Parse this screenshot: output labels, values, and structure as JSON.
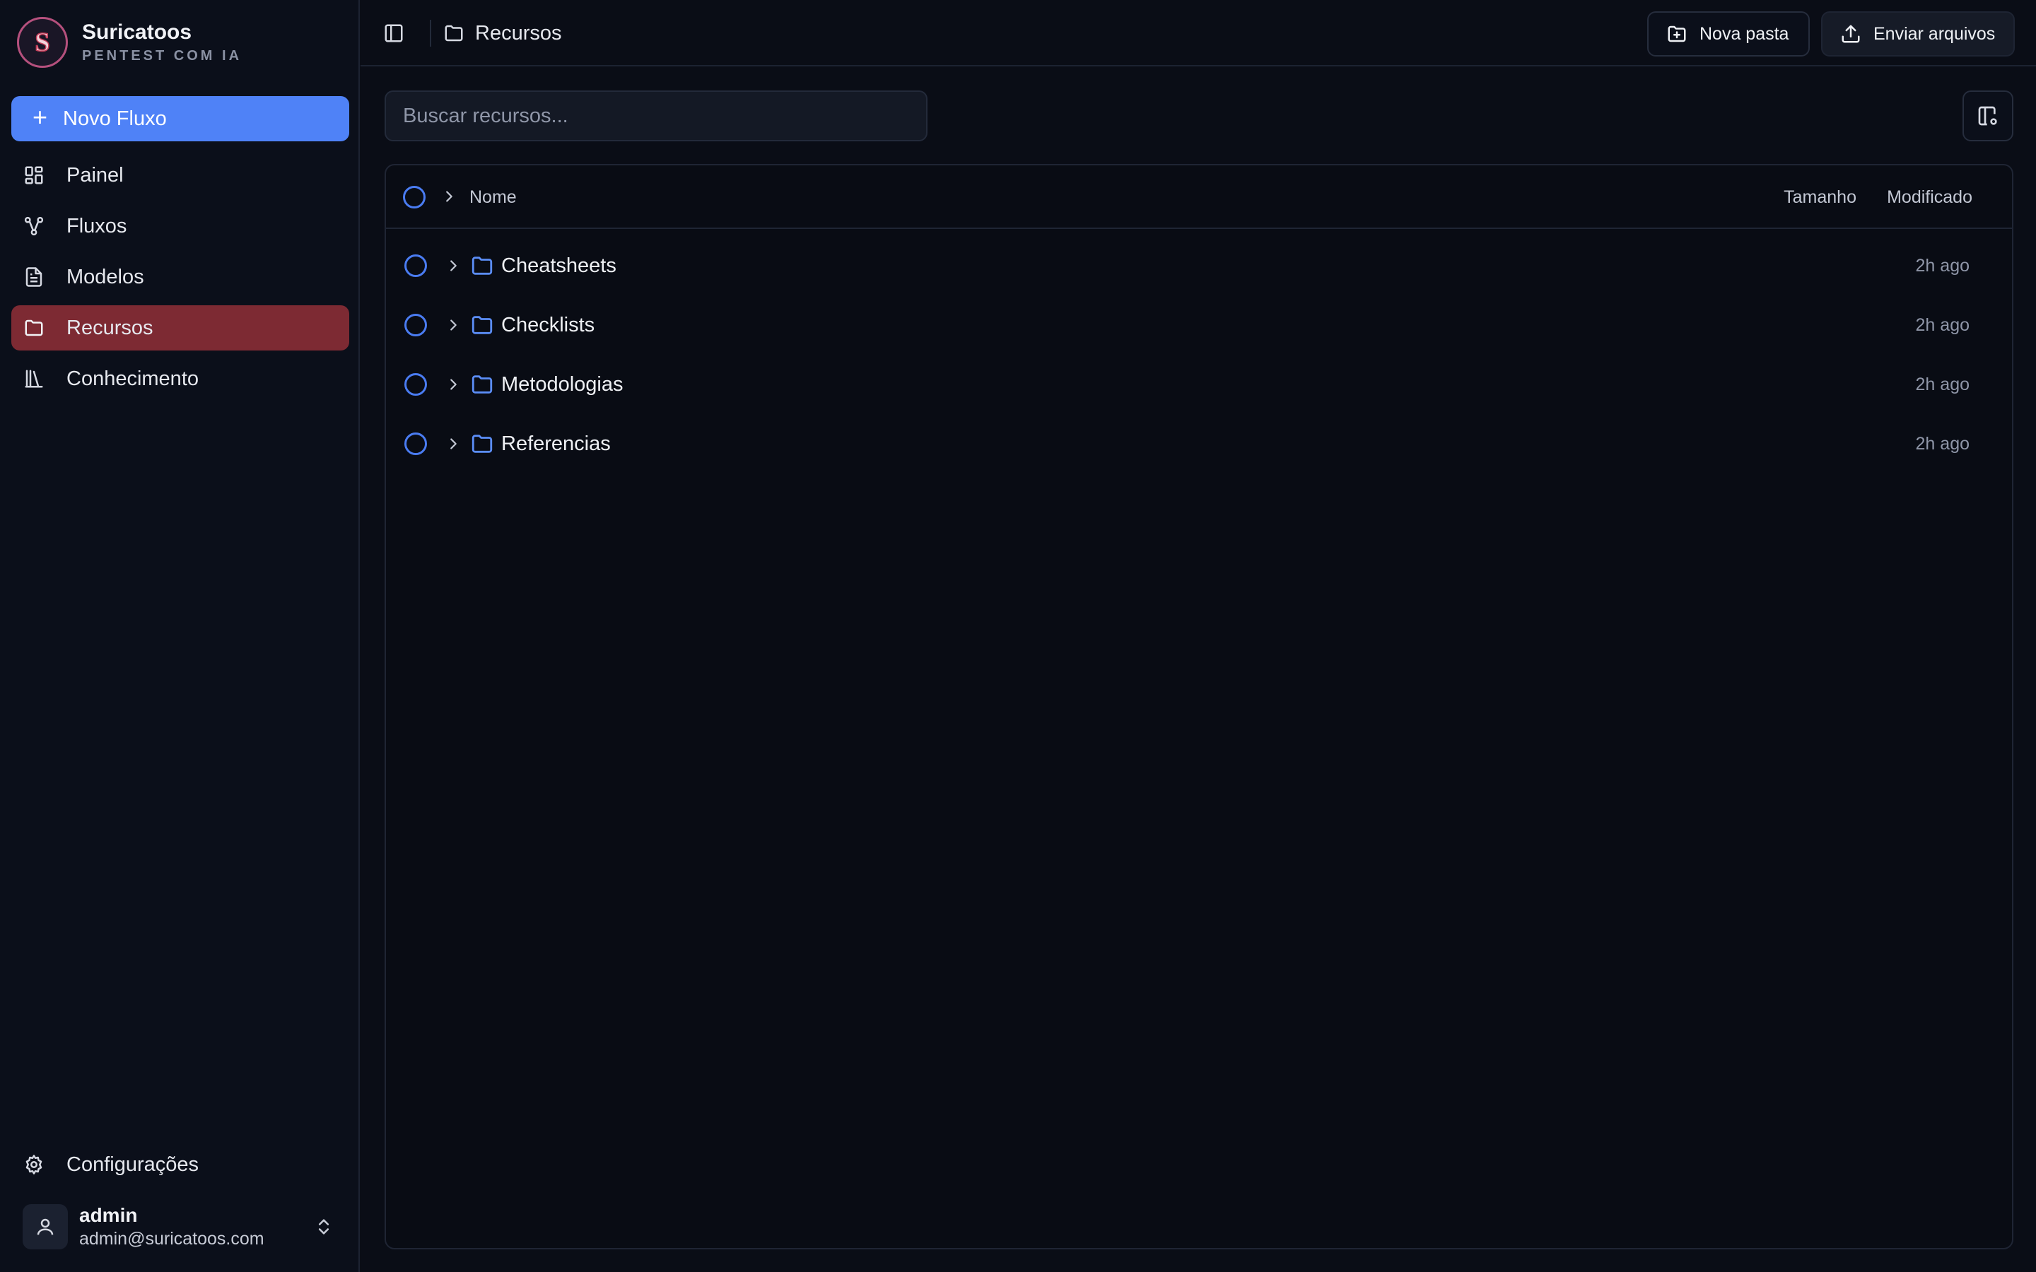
{
  "brand": {
    "name": "Suricatoos",
    "subtitle": "PENTEST COM IA",
    "logo_letter": "S"
  },
  "sidebar": {
    "new_flow_label": "Novo Fluxo",
    "items": [
      {
        "label": "Painel",
        "icon": "dashboard-icon",
        "active": false
      },
      {
        "label": "Fluxos",
        "icon": "workflow-icon",
        "active": false
      },
      {
        "label": "Modelos",
        "icon": "document-icon",
        "active": false
      },
      {
        "label": "Recursos",
        "icon": "folder-icon",
        "active": true
      },
      {
        "label": "Conhecimento",
        "icon": "library-icon",
        "active": false
      }
    ],
    "settings_label": "Configurações",
    "user": {
      "name": "admin",
      "email": "admin@suricatoos.com"
    }
  },
  "header": {
    "breadcrumb": "Recursos",
    "new_folder_label": "Nova pasta",
    "upload_label": "Enviar arquivos"
  },
  "search": {
    "placeholder": "Buscar recursos..."
  },
  "table": {
    "columns": {
      "name": "Nome",
      "size": "Tamanho",
      "modified": "Modificado"
    },
    "rows": [
      {
        "name": "Cheatsheets",
        "size": "",
        "modified": "2h ago"
      },
      {
        "name": "Checklists",
        "size": "",
        "modified": "2h ago"
      },
      {
        "name": "Metodologias",
        "size": "",
        "modified": "2h ago"
      },
      {
        "name": "Referencias",
        "size": "",
        "modified": "2h ago"
      }
    ]
  },
  "colors": {
    "accent": "#4f82f7",
    "active_nav": "#7d2a33",
    "background": "#0a0d16",
    "folder_icon": "#5b8df6"
  }
}
